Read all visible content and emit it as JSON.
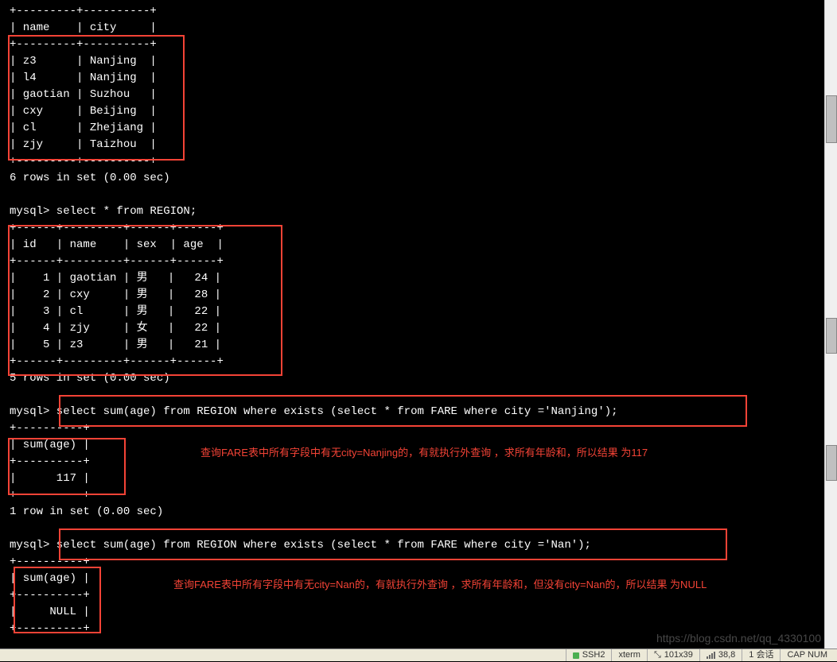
{
  "terminal": {
    "line01": "+---------+----------+",
    "line02": "| name    | city     |",
    "line03": "+---------+----------+",
    "line04": "| z3      | Nanjing  |",
    "line05": "| l4      | Nanjing  |",
    "line06": "| gaotian | Suzhou   |",
    "line07": "| cxy     | Beijing  |",
    "line08": "| cl      | Zhejiang |",
    "line09": "| zjy     | Taizhou  |",
    "line10": "+---------+----------+",
    "line11": "6 rows in set (0.00 sec)",
    "line12": "",
    "line13": "mysql> select * from REGION;",
    "line14": "+------+---------+------+------+",
    "line15": "| id   | name    | sex  | age  |",
    "line16": "+------+---------+------+------+",
    "line17": "|    1 | gaotian | 男   |   24 |",
    "line18": "|    2 | cxy     | 男   |   28 |",
    "line19": "|    3 | cl      | 男   |   22 |",
    "line20": "|    4 | zjy     | 女   |   22 |",
    "line21": "|    5 | z3      | 男   |   21 |",
    "line22": "+------+---------+------+------+",
    "line23": "5 rows in set (0.00 sec)",
    "line24": "",
    "line25": "mysql> select sum(age) from REGION where exists (select * from FARE where city ='Nanjing');",
    "line26": "+----------+",
    "line27": "| sum(age) |",
    "line28": "+----------+",
    "line29": "|      117 |",
    "line30": "+----------+",
    "line31": "1 row in set (0.00 sec)",
    "line32": "",
    "line33": "mysql> select sum(age) from REGION where exists (select * from FARE where city ='Nan');",
    "line34": "+----------+",
    "line35": "| sum(age) |",
    "line36": "+----------+",
    "line37": "|     NULL |",
    "line38": "+----------+"
  },
  "annotations": {
    "note1": "查询FARE表中所有字段中有无city=Nanjing的，有就执行外查询 ，求所有年龄和，所以结果 为117",
    "note2": "查询FARE表中所有字段中有无city=Nan的，有就执行外查询 ，求所有年龄和，但没有city=Nan的，所以结果 为NULL"
  },
  "statusbar": {
    "ssh": "SSH2",
    "term": "xterm",
    "size": "101x39",
    "pos": "38,8",
    "sess": "1 会话",
    "caps": "CAP  NUM"
  },
  "watermark": "https://blog.csdn.net/qq_4330100"
}
